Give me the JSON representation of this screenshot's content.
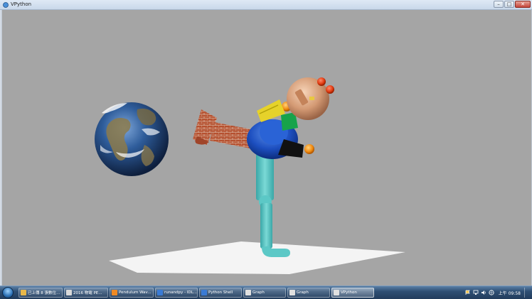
{
  "window": {
    "title": "VPython",
    "minimize_glyph": "–",
    "maximize_glyph": "□",
    "close_glyph": "✕"
  },
  "scene": {
    "background_color": "#a5a5a5",
    "floor_color": "#ffffff",
    "objects": [
      "earth-globe",
      "robot-figure",
      "floor-plane"
    ]
  },
  "taskbar": {
    "items": [
      {
        "label": "已上傳 8 張數位...",
        "icon_color": "#e8b84a"
      },
      {
        "label": "2016 物電 PE...",
        "icon_color": "#d9d9d9"
      },
      {
        "label": "Pendulum Wav...",
        "icon_color": "#f08a24"
      },
      {
        "label": "runandpy - IDL...",
        "icon_color": "#3a7bd5"
      },
      {
        "label": "Python Shell",
        "icon_color": "#3a7bd5"
      },
      {
        "label": "Graph",
        "icon_color": "#e0e0e0"
      },
      {
        "label": "Graph",
        "icon_color": "#e0e0e0"
      },
      {
        "label": "VPython",
        "icon_color": "#e0e0e0",
        "active": true
      }
    ],
    "tray_icons": [
      "flag-icon",
      "network-icon",
      "volume-icon",
      "language-icon"
    ],
    "clock": "上午 09:58"
  }
}
